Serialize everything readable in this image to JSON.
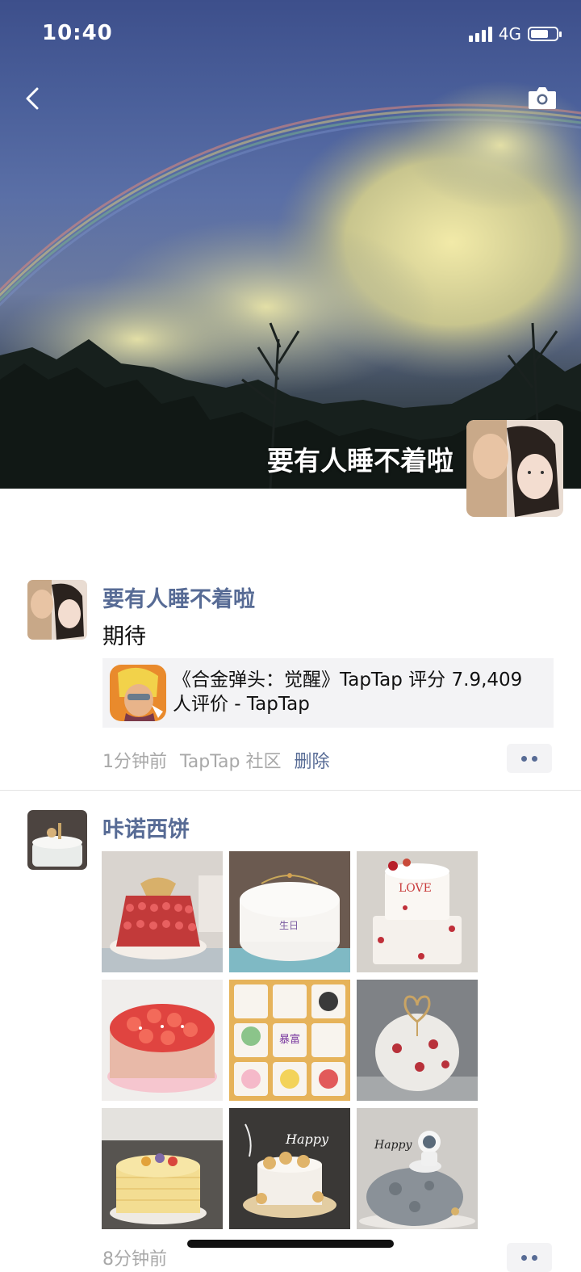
{
  "status": {
    "time": "10:40",
    "network": "4G",
    "battery_level": 0.7
  },
  "header": {
    "back_icon": "chevron-left-icon",
    "camera_icon": "camera-icon",
    "cover_name": "要有人睡不着啦"
  },
  "posts": [
    {
      "author": "要有人睡不着啦",
      "text": "期待",
      "link": {
        "title": "《合金弹头：觉醒》TapTap 评分 7.9,409 人评价 - TapTap"
      },
      "time": "1分钟前",
      "source": "TapTap 社区",
      "delete_label": "删除"
    },
    {
      "author": "咔诺西饼",
      "images": [
        "strawberry-tower-cake",
        "white-birthday-cake",
        "love-two-tier-cake",
        "strawberry-cake",
        "cupcake-box",
        "heart-topper-cake",
        "fruit-crepe-cake",
        "happy-birthday-cake",
        "astronaut-cake"
      ],
      "time": "8分钟前"
    }
  ],
  "colors": {
    "author": "#576b95",
    "meta": "#a8a8a8",
    "card_bg": "#f3f3f5"
  }
}
